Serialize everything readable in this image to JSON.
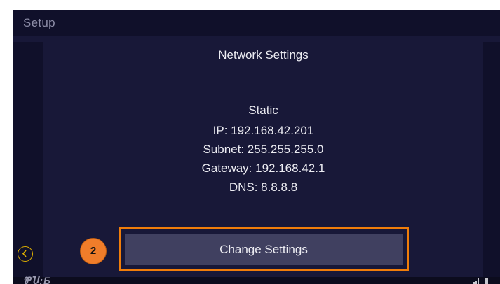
{
  "titlebar": {
    "title": "Setup"
  },
  "main": {
    "heading": "Network Settings",
    "network": {
      "mode": "Static",
      "ip": "IP: 192.168.42.201",
      "subnet": "Subnet: 255.255.255.0",
      "gateway": "Gateway: 192.168.42.1",
      "dns": "DNS: 8.8.8.8"
    },
    "change_button_label": "Change Settings"
  },
  "annotation": {
    "step_number": "2"
  },
  "footer": {
    "logo_text": "ᏈႮ:Ƃ"
  },
  "icons": {
    "back": "chevron-left-circle-icon",
    "signal": "signal-bars-icon",
    "battery": "battery-icon"
  },
  "colors": {
    "screen_background": "#181838",
    "panel_background": "#10102a",
    "button_background": "#404060",
    "highlight_border": "#f07d0a",
    "badge_fill": "#f07d2a",
    "back_icon": "#e0b000"
  }
}
